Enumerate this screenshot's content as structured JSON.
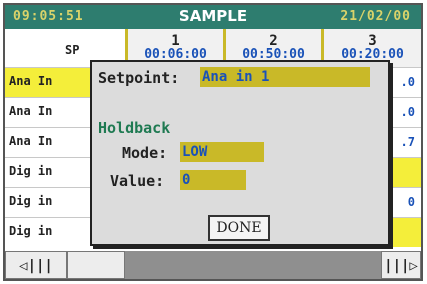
{
  "header": {
    "time": "09:05:51",
    "title": "SAMPLE",
    "date": "21/02/00"
  },
  "grid": {
    "sp_label": "SP",
    "columns": [
      {
        "num": "1",
        "time": "00:06:00"
      },
      {
        "num": "2",
        "time": "00:50:00"
      },
      {
        "num": "3",
        "time": "00:20:00"
      }
    ],
    "rows": [
      {
        "label": "Ana In"
      },
      {
        "label": "Ana In"
      },
      {
        "label": "Ana In"
      },
      {
        "label": "Dig in"
      },
      {
        "label": "Dig in"
      },
      {
        "label": "Dig in"
      }
    ],
    "visible_values": [
      ".0",
      ".0",
      ".7",
      "0"
    ]
  },
  "dialog": {
    "setpoint_label": "Setpoint:",
    "setpoint_value": "Ana in 1",
    "holdback_title": "Holdback",
    "mode_label": "Mode:",
    "mode_value": "LOW",
    "value_label": "Value:",
    "value_value": "0",
    "done_label": "DONE"
  },
  "footer": {
    "left_icon": "scroll-left-icon",
    "right_icon": "scroll-right-icon"
  }
}
